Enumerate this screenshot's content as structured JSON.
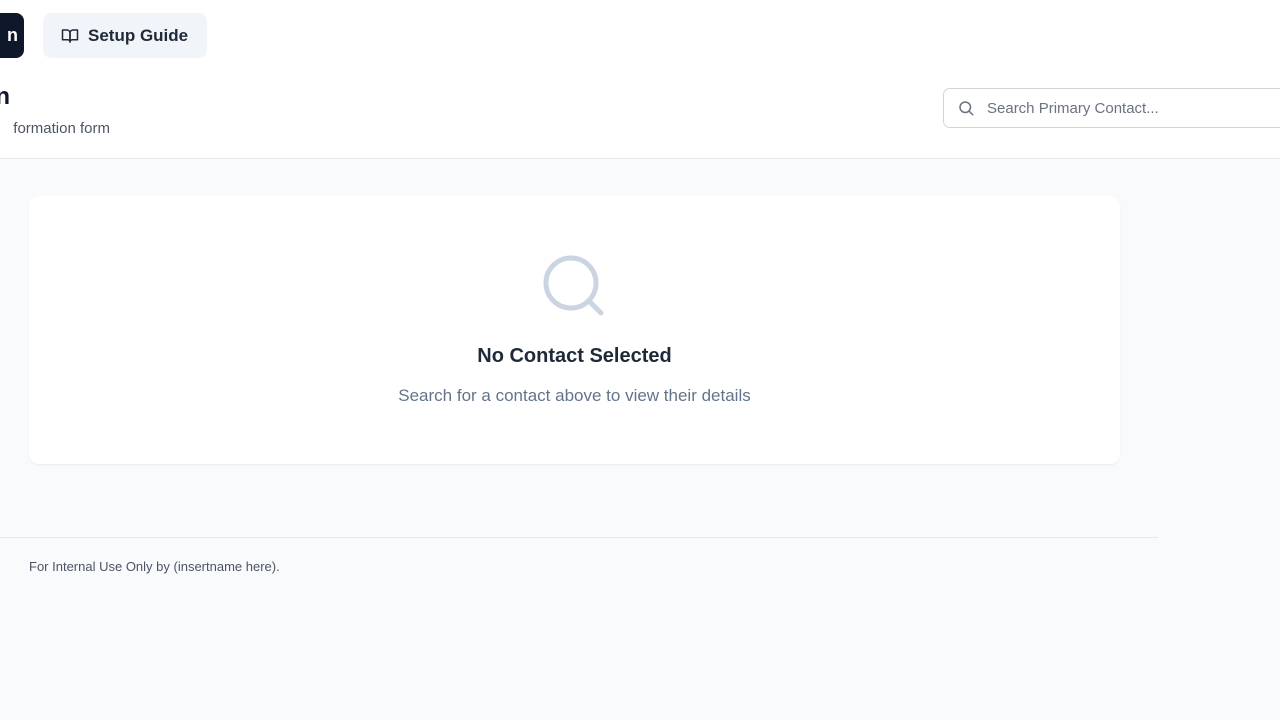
{
  "header": {
    "primary_button_label": "n",
    "guide_button_label": "Setup Guide",
    "title": "n",
    "subtitle": "formation form"
  },
  "search": {
    "placeholder": "Search Primary Contact...",
    "value": ""
  },
  "empty_state": {
    "icon": "search-icon",
    "title": "No Contact Selected",
    "description": "Search for a contact above to view their details"
  },
  "footer": {
    "text": "For Internal Use Only by (insertname here)."
  },
  "icons": {
    "guide": "book-open-icon",
    "search": "search-icon"
  },
  "colors": {
    "primary_button_bg": "#0f172a",
    "guide_button_bg": "#f1f5f9",
    "page_bg": "#f8fafc",
    "empty_icon": "#cbd5e1"
  }
}
